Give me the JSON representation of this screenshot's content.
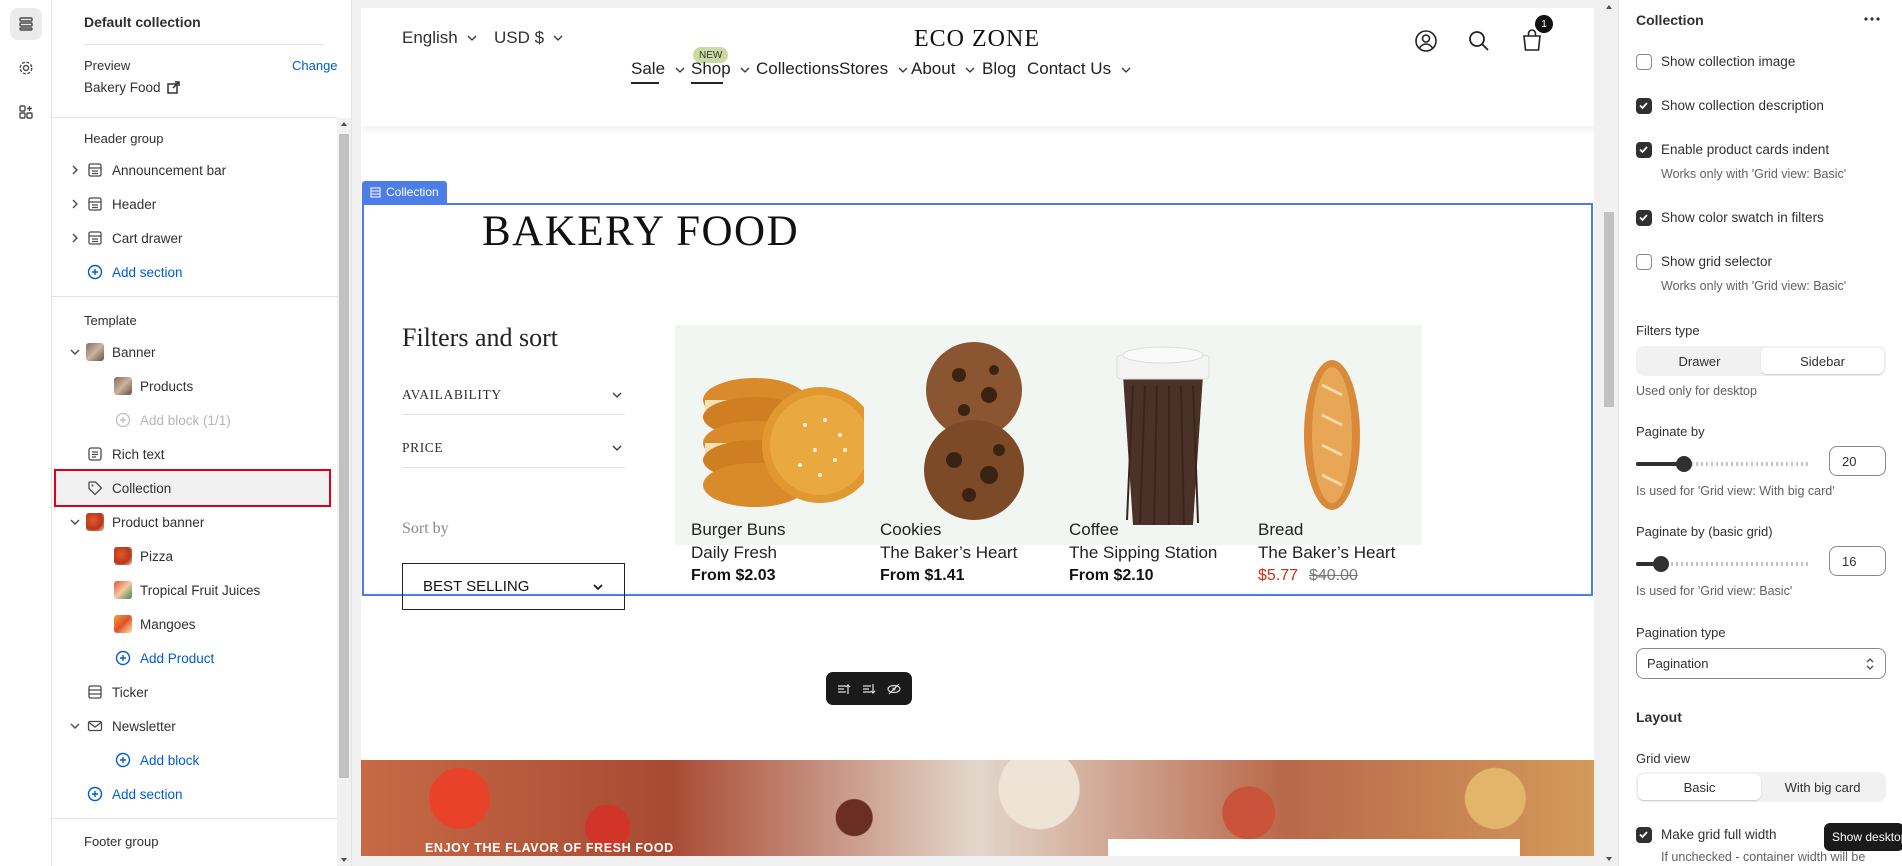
{
  "left_panel": {
    "title": "Default collection",
    "preview_label": "Preview",
    "preview_change": "Change",
    "preview_value": "Bakery Food",
    "header_group": "Header group",
    "header_items": [
      "Announcement bar",
      "Header",
      "Cart drawer"
    ],
    "add_section": "Add section",
    "template_label": "Template",
    "banner": "Banner",
    "banner_products": "Products",
    "add_block_count": "Add block (1/1)",
    "rich_text": "Rich text",
    "collection": "Collection",
    "product_banner": "Product banner",
    "pizza": "Pizza",
    "juices": "Tropical Fruit Juices",
    "mangoes": "Mangoes",
    "add_product": "Add Product",
    "ticker": "Ticker",
    "newsletter": "Newsletter",
    "add_block": "Add block",
    "add_section_2": "Add section",
    "footer_group": "Footer group"
  },
  "store": {
    "language": "English",
    "currency": "USD $",
    "logo": "ECO ZONE",
    "cart_count": "1",
    "new_badge": "NEW",
    "nav": [
      "Sale",
      "Shop",
      "Collections",
      "Stores",
      "About",
      "Blog",
      "Contact Us"
    ],
    "section_tag": "Collection",
    "collection_title": "BAKERY FOOD",
    "filters_title": "Filters and sort",
    "filter_availability": "AVAILABILITY",
    "filter_price": "PRICE",
    "sort_label": "Sort by",
    "sort_value": "BEST SELLING",
    "products": [
      {
        "name": "Burger Buns",
        "vendor": "Daily Fresh",
        "price": "From $2.03"
      },
      {
        "name": "Cookies",
        "vendor": "The Baker’s Heart",
        "price": "From $1.41"
      },
      {
        "name": "Coffee",
        "vendor": "The Sipping Station",
        "price": "From $2.10"
      },
      {
        "name": "Bread",
        "vendor": "The Baker’s Heart",
        "sale_price": "$5.77",
        "compare_price": "$40.00"
      }
    ],
    "banner_text": "ENJOY THE FLAVOR OF FRESH FOOD"
  },
  "right_panel": {
    "title": "Collection",
    "show_collection_image": "Show collection image",
    "show_collection_description": "Show collection description",
    "enable_indent": "Enable product cards indent",
    "works_basic": "Works only with 'Grid view: Basic'",
    "show_color_swatch": "Show color swatch in filters",
    "show_grid_selector": "Show grid selector",
    "works_basic_2": "Works only with 'Grid view: Basic'",
    "filters_type_label": "Filters type",
    "filters_type_options": [
      "Drawer",
      "Sidebar"
    ],
    "filters_type_note": "Used only for desktop",
    "paginate_label": "Paginate by",
    "paginate_value": "20",
    "paginate_note": "Is used for 'Grid view: With big card'",
    "paginate_basic_label": "Paginate by (basic grid)",
    "paginate_basic_value": "16",
    "paginate_basic_note": "Is used for 'Grid view: Basic'",
    "pagination_type_label": "Pagination type",
    "pagination_type_value": "Pagination",
    "layout_heading": "Layout",
    "grid_view_label": "Grid view",
    "grid_view_options": [
      "Basic",
      "With big card"
    ],
    "full_width": "Make grid full width",
    "full_width_note": "If unchecked - container width will be",
    "tooltip": "Show desktop"
  },
  "colors": {
    "accent_blue": "#005bd3",
    "selection_red": "#e0001b",
    "section_blue": "#4c7de8",
    "sale_red": "#d72c0d"
  }
}
